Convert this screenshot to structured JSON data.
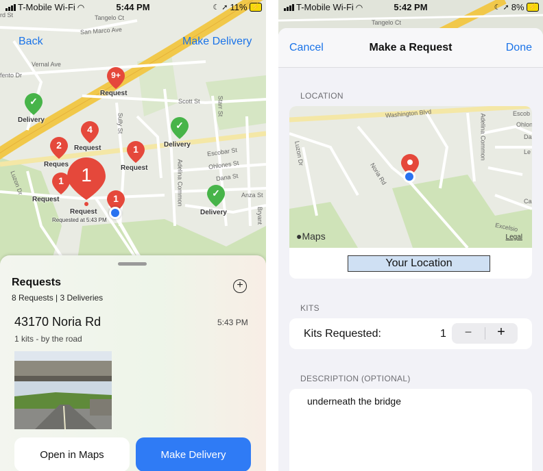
{
  "left": {
    "status": {
      "carrier": "T-Mobile Wi-Fi",
      "time": "5:44 PM",
      "battery": "11%"
    },
    "nav": {
      "back": "Back",
      "make_delivery": "Make Delivery"
    },
    "map": {
      "streets": [
        "Tangelo Ct",
        "San Marco Ave",
        "Vernal Ave",
        "Scott St",
        "Starr St",
        "Sully St",
        "Escobar St",
        "Ohlones St",
        "Dana St",
        "Anza St",
        "Adelina Common",
        "Luzon Dr",
        "Bryant",
        "fento Dr",
        "rd St"
      ],
      "pins": [
        {
          "badge": "9+",
          "label": "Request",
          "kind": "request"
        },
        {
          "badge": "",
          "label": "Delivery",
          "kind": "delivery"
        },
        {
          "badge": "4",
          "label": "Request",
          "kind": "request"
        },
        {
          "badge": "2",
          "label": "Reques",
          "kind": "request"
        },
        {
          "badge": "",
          "label": "Delivery",
          "kind": "delivery"
        },
        {
          "badge": "1",
          "label": "Request",
          "kind": "request"
        },
        {
          "badge": "1",
          "label": "Request",
          "kind": "request"
        },
        {
          "badge": "1",
          "label": "Request",
          "kind": "request",
          "sublabel": "Requested at 5:43 PM"
        },
        {
          "badge": "1",
          "label": "",
          "kind": "request"
        },
        {
          "badge": "",
          "label": "Delivery",
          "kind": "delivery"
        }
      ]
    },
    "sheet": {
      "title": "Requests",
      "summary": "8 Requests | 3 Deliveries",
      "address": "43170 Noria Rd",
      "time": "5:43 PM",
      "detail": "1 kits - by the road",
      "open_in_maps": "Open in Maps",
      "make_delivery": "Make Delivery"
    },
    "colors": {
      "accent": "#1a73e8",
      "request_pin": "#e5483b",
      "delivery_pin": "#47b449",
      "primary_button": "#2f7bf5"
    }
  },
  "right": {
    "status": {
      "carrier": "T-Mobile Wi-Fi",
      "time": "5:42 PM",
      "battery": "8%"
    },
    "behind_street": "Tangelo Ct",
    "header": {
      "cancel": "Cancel",
      "title": "Make a Request",
      "done": "Done"
    },
    "location": {
      "section": "LOCATION",
      "streets": [
        "Washington Blvd",
        "Luzon Dr",
        "Noria Rd",
        "Adelina Common",
        "Escob",
        "Ohlon",
        "Da",
        "Le",
        "Excelsio",
        "Ca"
      ],
      "maps_brand": "Maps",
      "legal": "Legal",
      "your_location": "Your Location"
    },
    "kits": {
      "section": "KITS",
      "label": "Kits Requested:",
      "value": "1",
      "minus": "−",
      "plus": "+"
    },
    "description": {
      "section": "DESCRIPTION (OPTIONAL)",
      "text": "underneath the bridge"
    }
  }
}
